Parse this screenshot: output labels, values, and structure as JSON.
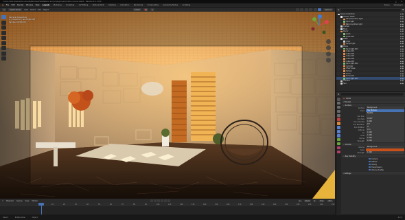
{
  "window": {
    "title": "/run/C:/Users/Users/Documents/Blender/Files/Nature and props/project/interior scene.blend - Blender 4.2.3 LTS"
  },
  "menubar": {
    "menus": [
      "File",
      "Edit",
      "Render",
      "Window",
      "Help"
    ],
    "workspaces": [
      "Layout",
      "Modeling",
      "Sculpting",
      "UV Editing",
      "Texture Paint",
      "Shading",
      "Animation",
      "Rendering",
      "Compositing",
      "Geometry Nodes",
      "Scripting"
    ],
    "active_workspace": "Layout",
    "scene": "Scene",
    "view_layer": "ViewLayer"
  },
  "viewport_header": {
    "mode": "Object Mode",
    "menus": [
      "View",
      "Select",
      "Add",
      "Object"
    ],
    "transform": "Global",
    "pivot": "Options"
  },
  "viewport_info": {
    "view": "Camera Perspective",
    "collection": "(1) Collection | Spot light.003",
    "samples": "Sample 1024/1024"
  },
  "timeline": {
    "menus": [
      "Playback",
      "Keying",
      "View",
      "Marker"
    ],
    "current_frame": "1",
    "start_label": "Start",
    "start": "1",
    "end_label": "End",
    "end": "250",
    "ruler": [
      "0",
      "10",
      "20",
      "30",
      "40",
      "50",
      "60",
      "70",
      "80",
      "90",
      "100",
      "110",
      "120",
      "130",
      "140",
      "150",
      "160",
      "170",
      "180",
      "190",
      "200",
      "210",
      "220",
      "230",
      "240",
      "250"
    ]
  },
  "statusbar": {
    "select": "Select",
    "rotate": "Rotate View",
    "context": "Object",
    "version": "4.2.3"
  },
  "outliner": {
    "search_placeholder": "",
    "items": [
      {
        "name": "Scene Collection",
        "color": "#cfcfcf",
        "indent": 0
      },
      {
        "name": "Interior Walls",
        "color": "#e5e5e5",
        "indent": 1
      },
      {
        "name": "Window frame light",
        "color": "#e38c4b",
        "indent": 2
      },
      {
        "name": "Spot light",
        "color": "#80c070",
        "indent": 2
      },
      {
        "name": "Balcony/other light",
        "color": "#e38c4b",
        "indent": 2
      },
      {
        "name": "Curtain",
        "color": "#cfcfcf",
        "indent": 1
      },
      {
        "name": "Floor",
        "color": "#cfcfcf",
        "indent": 1
      },
      {
        "name": "Decor",
        "color": "#e38c4b",
        "indent": 1
      },
      {
        "name": "plant",
        "color": "#80c070",
        "indent": 2
      },
      {
        "name": "plant.001",
        "color": "#80c070",
        "indent": 2
      },
      {
        "name": "Table",
        "color": "#cfcfcf",
        "indent": 1
      },
      {
        "name": "chair",
        "color": "#cfcfcf",
        "indent": 2
      },
      {
        "name": "Lamp light",
        "color": "#e38c4b",
        "indent": 2
      },
      {
        "name": "Plane",
        "color": "#cfcfcf",
        "indent": 1
      },
      {
        "name": "Spot light.001",
        "color": "#80c070",
        "indent": 2
      },
      {
        "name": "Cube.001",
        "color": "#e38c4b",
        "indent": 2
      },
      {
        "name": "Cube.002",
        "color": "#e38c4b",
        "indent": 2
      },
      {
        "name": "Cube.003",
        "color": "#e38c4b",
        "indent": 2
      },
      {
        "name": "Cube.004",
        "color": "#e38c4b",
        "indent": 2
      },
      {
        "name": "Cube.005",
        "color": "#e38c4b",
        "indent": 2
      },
      {
        "name": "Spot light.002",
        "color": "#80c070",
        "indent": 2
      },
      {
        "name": "Cylinder",
        "color": "#e38c4b",
        "indent": 2
      },
      {
        "name": "Chair base",
        "color": "#e38c4b",
        "indent": 2
      },
      {
        "name": "Sphere",
        "color": "#e38c4b",
        "indent": 2
      },
      {
        "name": "Torus",
        "color": "#e38c4b",
        "indent": 2
      },
      {
        "name": "Torus.001",
        "color": "#e38c4b",
        "indent": 2
      },
      {
        "name": "Spot light.003",
        "color": "#80c070",
        "indent": 2
      },
      {
        "name": "Camera",
        "color": "#cfcfcf",
        "indent": 1
      },
      {
        "name": "Sun",
        "color": "#cfcfcf",
        "indent": 1
      }
    ]
  },
  "properties": {
    "context": "World",
    "world_name": "World",
    "sections": {
      "preview": "Preview",
      "surface": "Surface",
      "volume": "Volume",
      "ray_visibility": "Ray Visibility",
      "settings": "Settings"
    },
    "fields": [
      {
        "label": "Surface",
        "value": "Background",
        "blue": false
      },
      {
        "label": "Color",
        "value": "Sky Texture",
        "blue": true
      },
      {
        "label": "",
        "value": "Nishita",
        "blue": false
      },
      {
        "label": "Sun Disc",
        "value": "",
        "blue": false
      },
      {
        "label": "Sun Size",
        "value": "0.545°",
        "blue": false
      },
      {
        "label": "Sun Intensity",
        "value": "1.000",
        "blue": false
      },
      {
        "label": "Sun Elevation",
        "value": "15°",
        "blue": false
      },
      {
        "label": "Sun Rotation",
        "value": "0°",
        "blue": false
      },
      {
        "label": "Altitude",
        "value": "0 m",
        "blue": false
      },
      {
        "label": "Air",
        "value": "1.000",
        "blue": false
      },
      {
        "label": "Dust",
        "value": "1.000",
        "blue": false
      },
      {
        "label": "Ozone",
        "value": "1.000",
        "blue": false
      },
      {
        "label": "Strength",
        "value": "1.000",
        "blue": false
      }
    ],
    "volume_fields": [
      {
        "label": "Volume",
        "value": "Background"
      },
      {
        "label": "Color",
        "value": ""
      },
      {
        "label": "Strength",
        "value": "1.000"
      }
    ],
    "ray_checks": [
      "Camera",
      "Diffuse",
      "Glossy",
      "Transmission",
      "Volume Scatter"
    ]
  },
  "colors": {
    "accent": "#4772b3",
    "bg": "#1d1d1d",
    "panel": "#2b2b2b"
  }
}
